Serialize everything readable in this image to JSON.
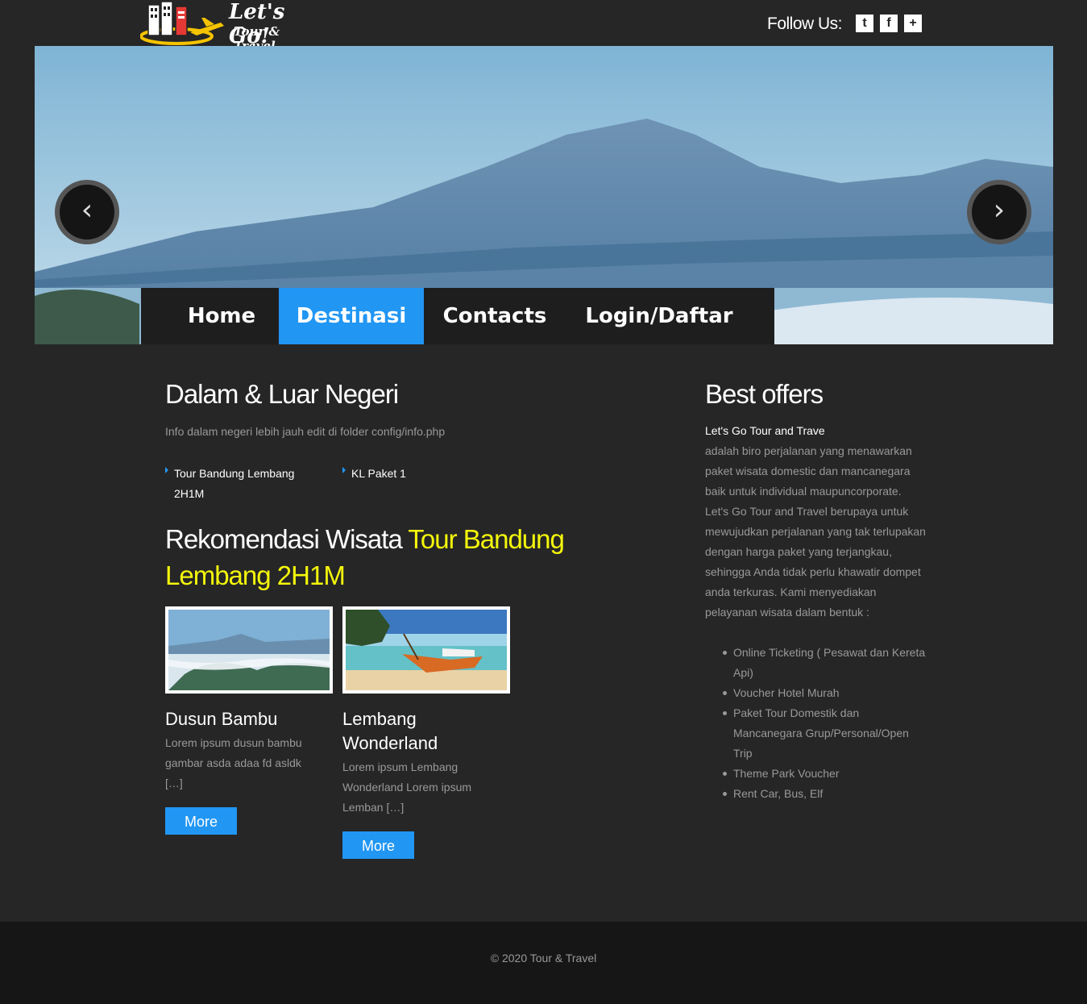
{
  "header": {
    "logo_line1": "Let's Go!",
    "logo_line2": "Tour & Travel",
    "follow_label": "Follow Us:",
    "social": [
      {
        "icon": "twitter-icon",
        "glyph": "t"
      },
      {
        "icon": "facebook-icon",
        "glyph": "f"
      },
      {
        "icon": "plus-icon",
        "glyph": "+"
      }
    ]
  },
  "slider": {
    "prev_glyph": "‹",
    "next_glyph": "›"
  },
  "nav": {
    "items": [
      {
        "label": "Home",
        "active": false
      },
      {
        "label": "Destinasi",
        "active": true
      },
      {
        "label": "Contacts",
        "active": false
      },
      {
        "label": "Login/Daftar",
        "active": false
      }
    ]
  },
  "main": {
    "title": "Dalam & Luar Negeri",
    "intro": "Info dalam negeri lebih jauh edit di folder config/info.php",
    "destinations": [
      "Tour Bandung Lembang 2H1M",
      "KL Paket 1"
    ],
    "reco_prefix": "Rekomendasi Wisata",
    "reco_highlight": "Tour Bandung Lembang 2H1M",
    "cards": [
      {
        "title": "Dusun Bambu",
        "desc": "Lorem ipsum dusun bambu gambar asda adaa fd asldk […]",
        "button": "More"
      },
      {
        "title": "Lembang Wonderland",
        "desc": "Lorem ipsum Lembang Wonderland Lorem ipsum Lemban […]",
        "button": "More"
      }
    ]
  },
  "sidebar": {
    "title": "Best offers",
    "subtitle": "Let's Go Tour and Trave",
    "text": "adalah biro perjalanan yang menawarkan paket wisata domestic dan mancanegara baik untuk individual maupuncorporate. Let's Go Tour and Travel berupaya untuk mewujudkan perjalanan yang tak terlupakan dengan harga paket yang terjangkau, sehingga Anda tidak perlu khawatir dompet anda terkuras. Kami menyediakan pelayanan wisata dalam bentuk :",
    "services": [
      "Online Ticketing ( Pesawat dan Kereta Api)",
      "Voucher Hotel Murah",
      "Paket Tour Domestik dan Mancanegara Grup/Personal/Open Trip",
      "Theme Park Voucher",
      "Rent Car, Bus, Elf"
    ]
  },
  "footer": {
    "copyright": "© 2020 Tour & Travel"
  },
  "colors": {
    "background": "#262626",
    "accent": "#2196f3",
    "highlight": "#f4f70b",
    "footer": "#161616"
  }
}
